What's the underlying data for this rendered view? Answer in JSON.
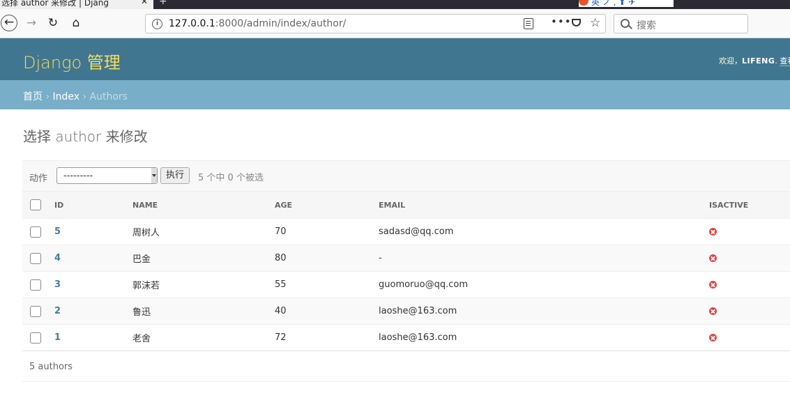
{
  "browser": {
    "tab_title": "选择 author 来修改 | Djang",
    "tab_close": "✕",
    "newtab": "+",
    "extension_text": "英 ノ , ⬆ ✈",
    "url_host": "127.0.0.1",
    "url_rest": ":8000/admin/index/author/",
    "search_placeholder": "搜索",
    "more": "•••",
    "star": "☆",
    "back": "←",
    "forward": "→",
    "reload": "↻",
    "home": "⌂"
  },
  "header": {
    "branding": "Django 管理",
    "welcome": "欢迎，",
    "username": "LIFENG",
    "link": "查看"
  },
  "breadcrumbs": {
    "home": "首页",
    "app": "Index",
    "current": "Authors",
    "sep": " › "
  },
  "page": {
    "title": "选择 author 来修改"
  },
  "actions": {
    "label": "动作",
    "selected_option": "---------",
    "go_button": "执行",
    "selection_count": "5 个中 0 个被选"
  },
  "table": {
    "columns": [
      "ID",
      "NAME",
      "AGE",
      "EMAIL",
      "ISACTIVE"
    ],
    "rows": [
      {
        "id": "5",
        "name": "周树人",
        "age": "70",
        "email": "sadasd@qq.com",
        "isactive": false
      },
      {
        "id": "4",
        "name": "巴金",
        "age": "80",
        "email": "-",
        "isactive": false
      },
      {
        "id": "3",
        "name": "郭沫若",
        "age": "55",
        "email": "guomoruo@qq.com",
        "isactive": false
      },
      {
        "id": "2",
        "name": "鲁迅",
        "age": "40",
        "email": "laoshe@163.com",
        "isactive": false
      },
      {
        "id": "1",
        "name": "老舍",
        "age": "72",
        "email": "laoshe@163.com",
        "isactive": false
      }
    ]
  },
  "paginator": {
    "text": "5 authors"
  }
}
